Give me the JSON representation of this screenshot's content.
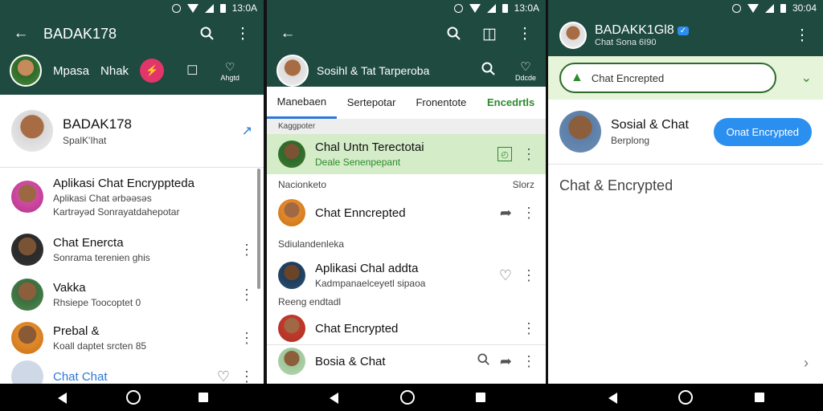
{
  "colors": {
    "header": "#1e4a3f",
    "accent_blue": "#2b8ff0",
    "accent_green": "#2d8a2d",
    "highlight_row": "#d4ecc8"
  },
  "panel1": {
    "status_time": "13:0A",
    "title": "BADAK178",
    "chips": [
      "Mpasa",
      "Nhak"
    ],
    "chip_icon_labels": [
      "Ahgtd"
    ],
    "profile": {
      "name": "BADAK178",
      "sub": "SpalK'Ihat"
    },
    "chats": [
      {
        "name": "Aplikasi Chat Encryppteda",
        "sub": "Aplikasi Chat ərbəəsəs",
        "sub2": "Kartrəyəd Sonrayatdahepotar"
      },
      {
        "name": "Chat Enercta",
        "sub": "Sonrama terenien ghis"
      },
      {
        "name": "Vakka",
        "sub": "Rhsiepe Toocoptet 0"
      },
      {
        "name": "Prebal &",
        "sub": "Koall daptet srcten 85"
      },
      {
        "name": "Chat Chat",
        "sub": ""
      }
    ]
  },
  "panel2": {
    "status_time": "13:0A",
    "title": "Sosihl & Tat Tarperoba",
    "header_icon_label": "Ddcde",
    "tabs": [
      "Manebaen",
      "Sertepotar",
      "Fronentote",
      "Encedrtls"
    ],
    "sections": {
      "s1": "Kaggpoter",
      "s2": "Nacionketo",
      "s2_right": "Slorz",
      "s3": "Sdiulandenleka",
      "s4": "Reeng endtadl"
    },
    "chats": [
      {
        "name": "Chal Untn Terectotai",
        "sub": "Deale Senenpepant"
      },
      {
        "name": "Chat Enncrepted",
        "sub": ""
      },
      {
        "name": "Aplikasi Chal addta",
        "sub": "Kadmpanaelceyetl sipaoa"
      },
      {
        "name": "Chat Encrypted",
        "sub": ""
      },
      {
        "name": "Bosia & Chat",
        "sub": ""
      }
    ]
  },
  "panel3": {
    "status_time": "30:04",
    "title": "BADAKK1Gl8",
    "subtitle": "Chat Sona 6I90",
    "search_value": "Chat Encrepted",
    "profile": {
      "name": "Sosial & Chat",
      "sub": "Berplong"
    },
    "button_label": "Onat Encrypted",
    "heading": "Chat & Encrypted"
  }
}
